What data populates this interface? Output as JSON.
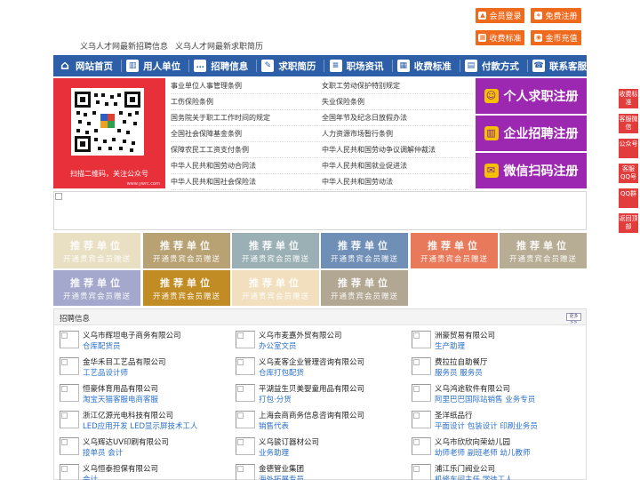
{
  "top_buttons": [
    {
      "label": "会员登录",
      "icon": "lock-icon",
      "glyph": "▲"
    },
    {
      "label": "免费注册",
      "icon": "user-plus-icon",
      "glyph": "+"
    },
    {
      "label": "收费标准",
      "icon": "calendar-icon",
      "glyph": "▦"
    },
    {
      "label": "金币充值",
      "icon": "coin-icon",
      "glyph": "◉"
    }
  ],
  "tagline": [
    "义乌人才网最新招聘信息",
    "义乌人才网最新求职简历"
  ],
  "nav": [
    {
      "label": "网站首页",
      "icon": "home-icon",
      "glyph": "⌂"
    },
    {
      "label": "用人单位",
      "icon": "building-icon",
      "glyph": "▥"
    },
    {
      "label": "招聘信息",
      "icon": "chat-icon",
      "glyph": "…"
    },
    {
      "label": "求职简历",
      "icon": "resume-icon",
      "glyph": "✎"
    },
    {
      "label": "职场资讯",
      "icon": "news-icon",
      "glyph": "≡"
    },
    {
      "label": "收费标准",
      "icon": "calendar-icon",
      "glyph": "▦"
    },
    {
      "label": "付款方式",
      "icon": "payment-icon",
      "glyph": "▤"
    },
    {
      "label": "联系客服",
      "icon": "phone-icon",
      "glyph": "☎"
    }
  ],
  "qr_caption": "扫描二维码，关注公众号",
  "qr_small": "www.ywrc.com",
  "laws": [
    [
      "事业单位人事管理条例",
      "女职工劳动保护特别规定"
    ],
    [
      "工伤保险条例",
      "失业保险条例"
    ],
    [
      "国务院关于职工工作时间的规定",
      "全国年节及纪念日放假办法"
    ],
    [
      "全国社会保障基金条例",
      "人力资源市场暂行条例"
    ],
    [
      "保障农民工工资支付条例",
      "中华人民共和国劳动争议调解仲裁法"
    ],
    [
      "中华人民共和国劳动合同法",
      "中华人民共和国就业促进法"
    ],
    [
      "中华人民共和国社会保险法",
      "中华人民共和国劳动法"
    ]
  ],
  "register_buttons": [
    {
      "label": "个人求职注册",
      "icon": "person-icon",
      "glyph": "☺"
    },
    {
      "label": "企业招聘注册",
      "icon": "company-icon",
      "glyph": "▥"
    },
    {
      "label": "微信扫码注册",
      "icon": "wechat-icon",
      "glyph": "✉"
    }
  ],
  "recommend_tile": {
    "title": "推荐单位",
    "subtitle": "开通贵宾会员赠送"
  },
  "recommend_colors": [
    "#e9dfc3",
    "#b8a274",
    "#9ab0b4",
    "#6f8fb6",
    "#e8795a",
    "#b7ad95",
    "#a4a8cc",
    "#c28c24",
    "#f1dfbd",
    "#b2a792"
  ],
  "jobs_title": "招聘信息",
  "more_label": "更多>>",
  "jobs": [
    {
      "company": "义乌市辉坦电子商务有限公司",
      "position": "仓库配货员"
    },
    {
      "company": "义乌市麦嘉外贸有限公司",
      "position": "办公室文员"
    },
    {
      "company": "洲豪贸易有限公司",
      "position": "生产助理"
    },
    {
      "company": "金华禾目工艺品有限公司",
      "position": "工艺品设计师"
    },
    {
      "company": "义乌麦客企业管理咨询有限公司",
      "position": "仓库打包配货"
    },
    {
      "company": "费拉拉自助餐厅",
      "position": "服务员 服务员"
    },
    {
      "company": "恒豪体育用品有限公司",
      "position": "淘宝天猫客服电商客服"
    },
    {
      "company": "平湖益生贝美婴童用品有限公司",
      "position": "打包·分货"
    },
    {
      "company": "义乌鸿途软件有限公司",
      "position": "阿里巴巴国际站销售 业务专员"
    },
    {
      "company": "浙江亿源光电科技有限公司",
      "position": "LED应用开发 LED显示屏技术工人"
    },
    {
      "company": "上海会商商务信息咨询有限公司",
      "position": "销售代表"
    },
    {
      "company": "圣洋纸品行",
      "position": "平面设计 包装设计 印刷业务员"
    },
    {
      "company": "义乌辉达UV印刷有限公司",
      "position": "接单员 会计"
    },
    {
      "company": "义乌骏订器材公司",
      "position": "业务助理"
    },
    {
      "company": "义乌市欣欣向荣幼儿园",
      "position": "幼师老师 副班老师 幼儿教师"
    },
    {
      "company": "义乌恒泰担保有限公司",
      "position": "会计"
    },
    {
      "company": "金德管业集团",
      "position": "海外拓展专员"
    },
    {
      "company": "浦江乐门阀业公司",
      "position": "机修车间主任 学徒工人"
    }
  ],
  "side_tabs": [
    "收费标准",
    "客服微信",
    "公众号",
    "客服QQ号",
    "QQ群",
    "返回顶部"
  ]
}
